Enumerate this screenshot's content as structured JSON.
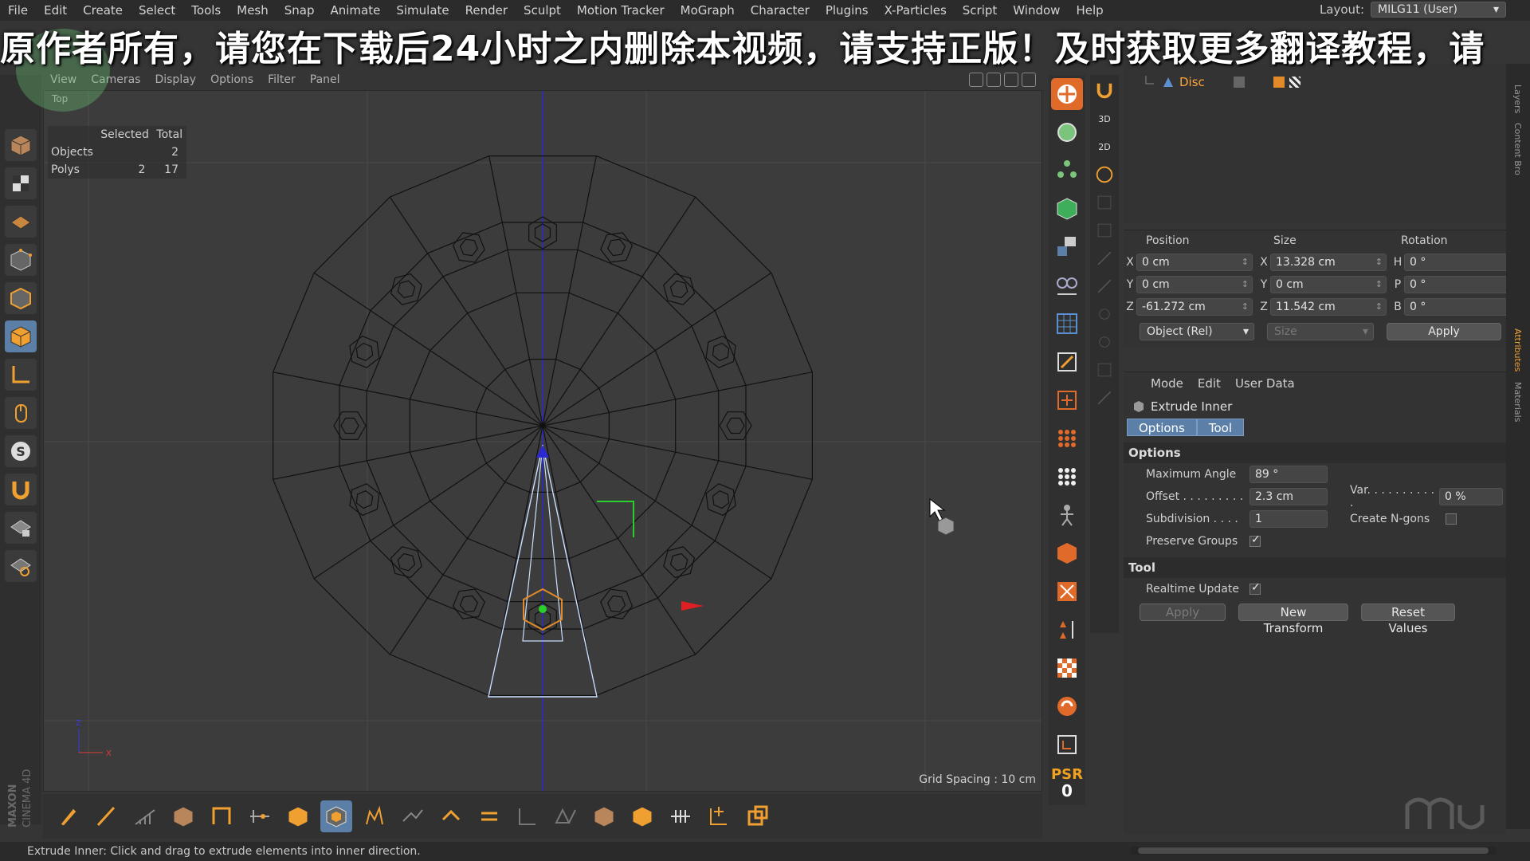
{
  "menubar": {
    "items": [
      "File",
      "Edit",
      "Create",
      "Select",
      "Tools",
      "Mesh",
      "Snap",
      "Animate",
      "Simulate",
      "Render",
      "Sculpt",
      "Motion Tracker",
      "MoGraph",
      "Character",
      "Plugins",
      "X-Particles",
      "Script",
      "Window",
      "Help"
    ],
    "layout_label": "Layout:",
    "layout_value": "MILG11 (User)"
  },
  "banner": {
    "text": "原作者所有，请您在下载后24小时之内删除本视频，请支持正版！及时获取更多翻译教程，请"
  },
  "viewport": {
    "menu": [
      "View",
      "Cameras",
      "Display",
      "Options",
      "Filter",
      "Panel"
    ],
    "camera_label": "Top",
    "stats": {
      "header_selected": "Selected",
      "header_total": "Total",
      "rows": [
        {
          "label": "Objects",
          "selected": "",
          "total": "2"
        },
        {
          "label": "Polys",
          "selected": "2",
          "total": "17"
        }
      ]
    },
    "grid_spacing": "Grid Spacing : 10 cm",
    "axis_labels": {
      "z": "Z",
      "x": "X"
    }
  },
  "status_bar": {
    "text": "Extrude Inner: Click and drag to extrude elements into inner direction."
  },
  "palette": {
    "psr_label": "PSR",
    "psr_value": "0",
    "side_labels": [
      "3D",
      "2D"
    ]
  },
  "object_manager": {
    "object_name": "Disc"
  },
  "coordinates": {
    "headers": [
      "Position",
      "Size",
      "Rotation"
    ],
    "rows": [
      {
        "axis": "X",
        "pos": "0 cm",
        "size_axis": "X",
        "size": "13.328 cm",
        "rot_axis": "H",
        "rot": "0 °"
      },
      {
        "axis": "Y",
        "pos": "0 cm",
        "size_axis": "Y",
        "size": "0 cm",
        "rot_axis": "P",
        "rot": "0 °"
      },
      {
        "axis": "Z",
        "pos": "-61.272 cm",
        "size_axis": "Z",
        "size": "11.542 cm",
        "rot_axis": "B",
        "rot": "0 °"
      }
    ],
    "mode_dropdown": "Object (Rel)",
    "size_dropdown": "Size",
    "apply": "Apply"
  },
  "attributes": {
    "menu": [
      "Mode",
      "Edit",
      "User Data"
    ],
    "title": "Extrude Inner",
    "tabs": [
      "Options",
      "Tool"
    ],
    "options_section": "Options",
    "max_angle_label": "Maximum Angle",
    "max_angle_value": "89 °",
    "offset_label": "Offset . . . . . . . . .",
    "offset_value": "2.3 cm",
    "var_label": "Var. . . . . . . . . . .",
    "var_value": "0 %",
    "subdivision_label": "Subdivision . . . .",
    "subdivision_value": "1",
    "create_ngons_label": "Create N-gons",
    "preserve_groups_label": "Preserve Groups",
    "tool_section": "Tool",
    "realtime_update_label": "Realtime Update",
    "buttons": {
      "apply": "Apply",
      "new_transform": "New Transform",
      "reset_values": "Reset Values"
    }
  },
  "right_tabs": [
    "Layers",
    "Content Bro",
    "Attributes",
    "Materials"
  ],
  "branding": {
    "vendor": "MAXON",
    "product": "CINEMA 4D"
  },
  "colors": {
    "accent_blue": "#5b7fa6",
    "orange": "#f0a030",
    "selection_orange": "#ffa43a"
  }
}
